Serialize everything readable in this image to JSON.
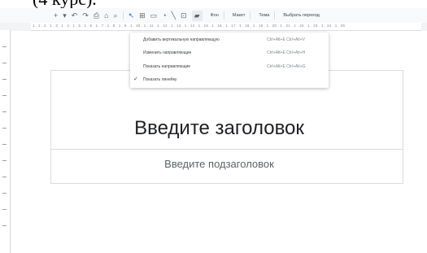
{
  "caption_fragment": "(4 курс).",
  "toolbar": {
    "icons": [
      "add-icon",
      "chevron-down-icon",
      "undo-icon",
      "redo-icon",
      "print-icon",
      "paint-format-icon",
      "zoom-icon",
      "select-icon",
      "text-box-icon",
      "image-icon",
      "shape-icon",
      "line-icon",
      "comment-icon",
      "background-icon"
    ],
    "background_label": "Фон",
    "layout_label": "Макет",
    "theme_label": "Тема",
    "transition_label": "Выбрать переход"
  },
  "ruler": {
    "numbers": "1 . 1 . 2 . 1 . 3 . 1 . 4 . 1 . 5 . 1 . 6 . 1 . 7 . 1 . 8 . 1 . 9 . 1 . 10 . 1 . 11 . 1 . 12 . 1 . 13 . 1 . 14 . 1 . 15 . 1 . 16 . 1 . 17 . 1 . 18 . 1 . 19 . 1 . 20 . 1 . 21 . 1 . 22 . 1 . 23 . 1 . 24 . 1 . 25"
  },
  "menu": {
    "items": [
      {
        "label": "Добавить вертикальную направляющую",
        "shortcut": "Ctrl+Alt+E Ctrl+Alt+V",
        "checked": false
      },
      {
        "label": "Изменить направляющие",
        "shortcut": "Ctrl+Alt+E Ctrl+Alt+H",
        "checked": false
      },
      {
        "label": "Показать направляющие",
        "shortcut": "Ctrl+Alt+E Ctrl+Alt+G",
        "checked": false
      },
      {
        "label": "Показать линейку",
        "shortcut": "",
        "checked": true
      }
    ]
  },
  "slide": {
    "title_placeholder": "Введите заголовок",
    "subtitle_placeholder": "Введите подзаголовок"
  }
}
